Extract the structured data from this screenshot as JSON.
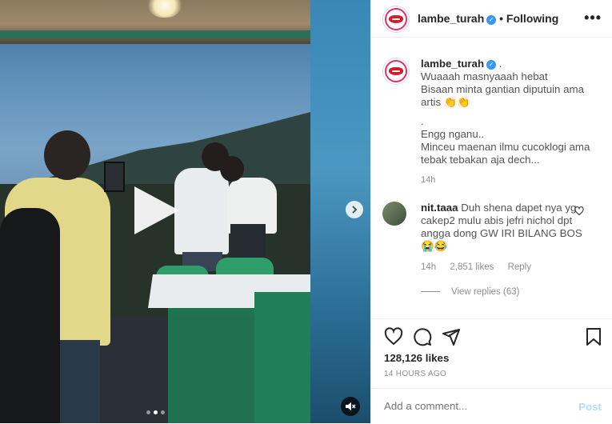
{
  "post": {
    "username": "lambe_turah",
    "following_label": "• Following",
    "more_icon": "more-horizontal-icon",
    "caption": {
      "username": "lambe_turah",
      "suffix": " .",
      "lines": [
        "Wuaaah masnyaaah hebat",
        "Bisaan minta gantian diputuin ama",
        "artis 👏👏",
        ".",
        "Engg nganu..",
        "Minceu maenan ilmu cucoklogi ama",
        "tebak tebakan aja dech..."
      ],
      "timestamp": "14h"
    },
    "comment": {
      "username": "nit.taaa",
      "text": " Duh shena dapet nya yg cakep2 mulu abis jefri nichol dpt angga dong GW IRI BILANG BOS 😭😂",
      "time": "14h",
      "likes": "2,851 likes",
      "reply_label": "Reply",
      "view_replies": "View replies (63)"
    },
    "likes_count": "128,126 likes",
    "posted_ago": "14 HOURS AGO",
    "add_comment_placeholder": "Add a comment...",
    "post_label": "Post"
  },
  "media": {
    "carousel_dots": 3,
    "active_dot": 1
  },
  "colors": {
    "verified": "#3897f0",
    "post_disabled": "#b3dbff",
    "avatar_ring": "#e1306c"
  }
}
